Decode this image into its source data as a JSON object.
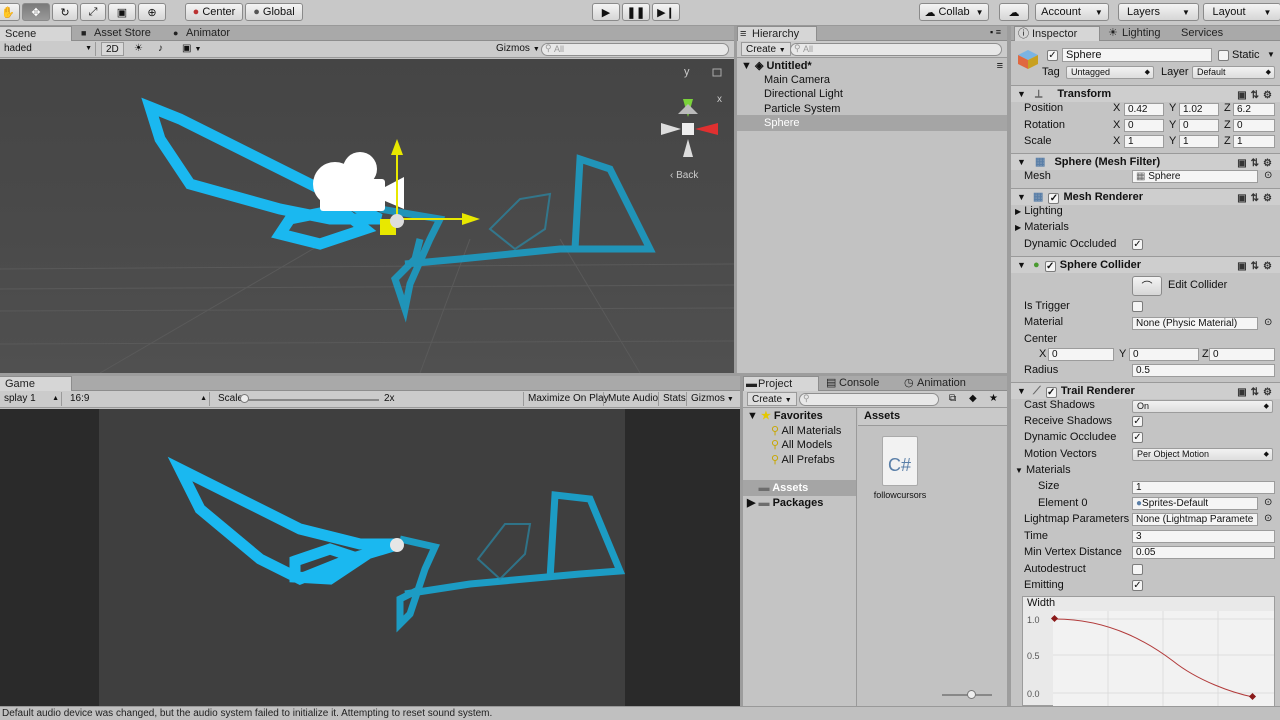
{
  "toolbar": {
    "tool_icons": [
      "hand-icon",
      "move-icon",
      "rotate-icon",
      "scale-icon",
      "rect-icon",
      "transform-icon"
    ],
    "center_label": "Center",
    "global_label": "Global",
    "collab_label": "Collab",
    "account_label": "Account",
    "layers_label": "Layers",
    "layout_label": "Layout"
  },
  "scene": {
    "tabs": [
      "Scene",
      "Asset Store",
      "Animator"
    ],
    "shading_value": "haded",
    "mode_2d": "2D",
    "gizmos_label": "Gizmos",
    "search_placeholder": "All",
    "back_label": "Back",
    "axis_y": "y",
    "axis_x": "x"
  },
  "game": {
    "tab": "Game",
    "display_value": "splay 1",
    "aspect_value": "16:9",
    "scale_label": "Scale",
    "scale_value": "2x",
    "maximize_label": "Maximize On Play",
    "mute_label": "Mute Audio",
    "stats_label": "Stats",
    "gizmos_label": "Gizmos"
  },
  "hierarchy": {
    "tab": "Hierarchy",
    "create_label": "Create",
    "search_placeholder": "All",
    "scene_name": "Untitled*",
    "items": [
      "Main Camera",
      "Directional Light",
      "Particle System",
      "Sphere"
    ]
  },
  "project": {
    "tabs": [
      "Project",
      "Console",
      "Animation"
    ],
    "create_label": "Create",
    "favorites_label": "Favorites",
    "favorites": [
      "All Materials",
      "All Models",
      "All Prefabs"
    ],
    "assets_label": "Assets",
    "packages_label": "Packages",
    "assets_header": "Assets",
    "file_icon_text": "C#",
    "file_name": "followcursors"
  },
  "inspector": {
    "tabs": [
      "Inspector",
      "Lighting",
      "Services"
    ],
    "object_name": "Sphere",
    "static_label": "Static",
    "tag_label": "Tag",
    "tag_value": "Untagged",
    "layer_label": "Layer",
    "layer_value": "Default",
    "transform": {
      "title": "Transform",
      "position_label": "Position",
      "rotation_label": "Rotation",
      "scale_label": "Scale",
      "x": "X",
      "y": "Y",
      "z": "Z",
      "position": [
        "0.42",
        "1.02",
        "6.2"
      ],
      "rotation": [
        "0",
        "0",
        "0"
      ],
      "scale": [
        "1",
        "1",
        "1"
      ]
    },
    "mesh_filter": {
      "title": "Sphere (Mesh Filter)",
      "mesh_label": "Mesh",
      "mesh_value": "Sphere"
    },
    "mesh_renderer": {
      "title": "Mesh Renderer",
      "lighting_label": "Lighting",
      "materials_label": "Materials",
      "dynamic_occluded_label": "Dynamic Occluded"
    },
    "sphere_collider": {
      "title": "Sphere Collider",
      "edit_label": "Edit Collider",
      "is_trigger_label": "Is Trigger",
      "material_label": "Material",
      "material_value": "None (Physic Material)",
      "center_label": "Center",
      "center": [
        "0",
        "0",
        "0"
      ],
      "radius_label": "Radius",
      "radius_value": "0.5"
    },
    "trail_renderer": {
      "title": "Trail Renderer",
      "cast_shadows_label": "Cast Shadows",
      "cast_shadows_value": "On",
      "receive_shadows_label": "Receive Shadows",
      "dynamic_occludee_label": "Dynamic Occludee",
      "motion_vectors_label": "Motion Vectors",
      "motion_vectors_value": "Per Object Motion",
      "materials_label": "Materials",
      "size_label": "Size",
      "size_value": "1",
      "element0_label": "Element 0",
      "element0_value": "Sprites-Default",
      "lightmap_label": "Lightmap Parameters",
      "lightmap_value": "None (Lightmap Paramete",
      "time_label": "Time",
      "time_value": "3",
      "min_vertex_label": "Min Vertex Distance",
      "min_vertex_value": "0.05",
      "autodestruct_label": "Autodestruct",
      "emitting_label": "Emitting",
      "width_label": "Width",
      "width_ticks": [
        "1.0",
        "0.5",
        "0.0"
      ]
    }
  },
  "status": {
    "message": "Default audio device was changed, but the audio system failed to initialize it. Attempting to reset sound system."
  },
  "colors": {
    "trail": "#1ab8f0",
    "trail_far": "#1c9cc4",
    "selection": "#a5a5a5",
    "curve": "#b23b3b"
  }
}
